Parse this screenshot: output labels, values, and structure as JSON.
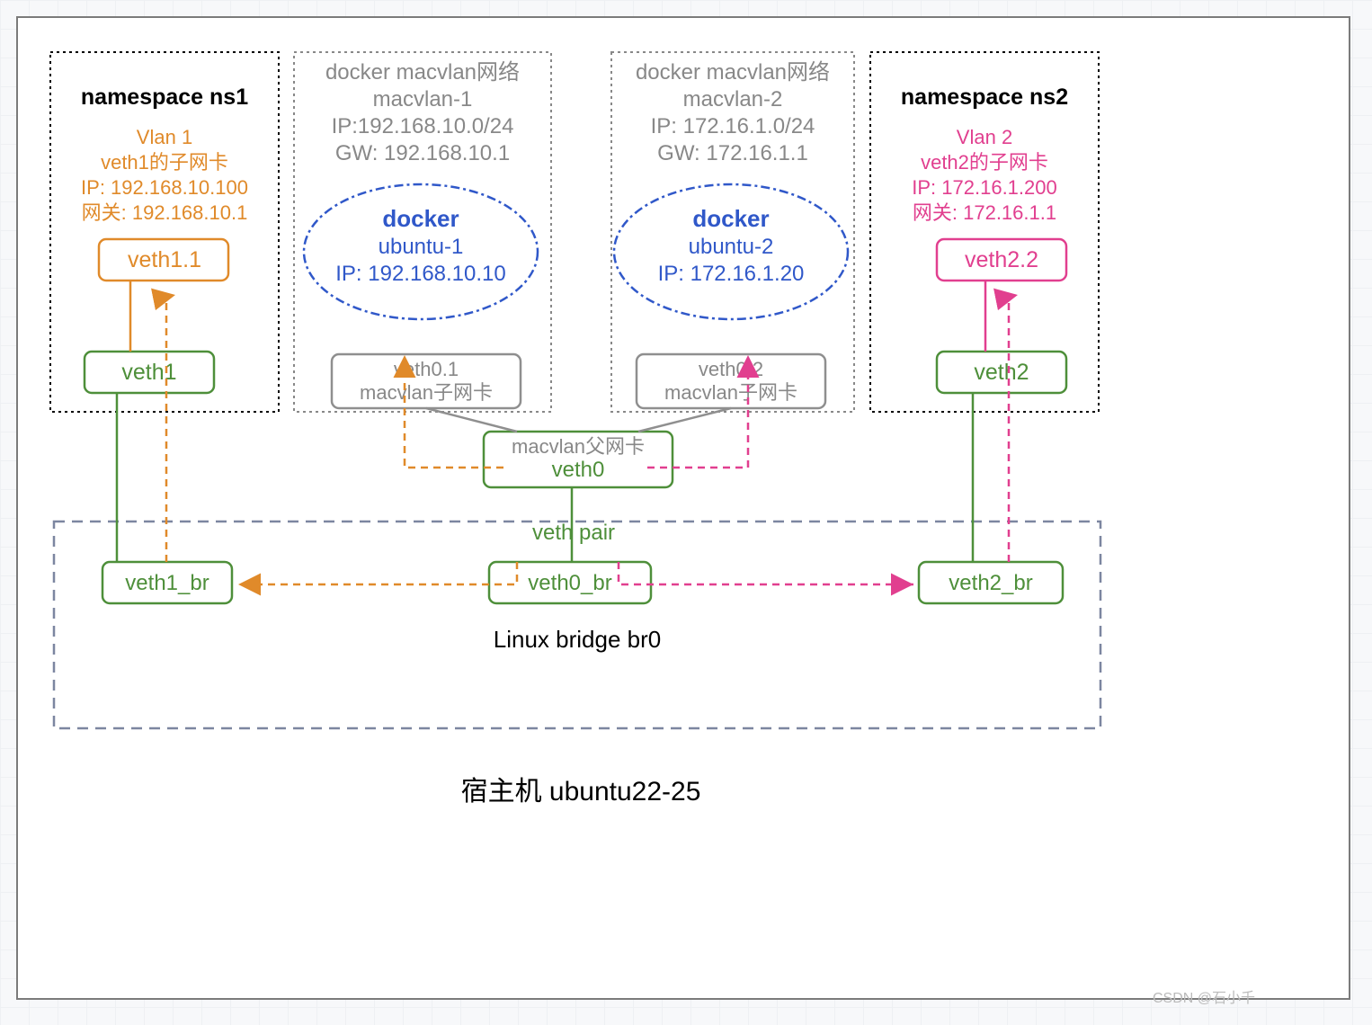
{
  "host": {
    "label": "宿主机 ubuntu22-25"
  },
  "bridge": {
    "label": "Linux bridge br0",
    "box_color": "#7c86a0"
  },
  "veth_pair_label": "veth  pair",
  "ns1": {
    "title": "namespace ns1",
    "vlan_title": "Vlan 1",
    "vlan_sub": "veth1的子网卡",
    "vlan_ip": "IP: 192.168.10.100",
    "vlan_gw": "网关: 192.168.10.1",
    "sub_if": "veth1.1",
    "if": "veth1",
    "color": "#e08a2a"
  },
  "ns2": {
    "title": "namespace ns2",
    "vlan_title": "Vlan 2",
    "vlan_sub": "veth2的子网卡",
    "vlan_ip": "IP: 172.16.1.200",
    "vlan_gw": "网关: 172.16.1.1",
    "sub_if": "veth2.2",
    "if": "veth2",
    "color": "#e13f8f"
  },
  "mvnet1": {
    "title": "docker macvlan网络",
    "name": "macvlan-1",
    "ip": "IP:192.168.10.0/24",
    "gw": "GW: 192.168.10.1",
    "docker_label": "docker",
    "container": "ubuntu-1",
    "container_ip": "IP: 192.168.10.10",
    "sub_if_name": "veth0.1",
    "sub_if_desc": "macvlan子网卡"
  },
  "mvnet2": {
    "title": "docker macvlan网络",
    "name": "macvlan-2",
    "ip": "IP: 172.16.1.0/24",
    "gw": "GW: 172.16.1.1",
    "docker_label": "docker",
    "container": "ubuntu-2",
    "container_ip": "IP: 172.16.1.20",
    "sub_if_name": "veth0.2",
    "sub_if_desc": "macvlan子网卡"
  },
  "parent": {
    "desc": "macvlan父网卡",
    "name": "veth0"
  },
  "br_ports": {
    "p1": "veth1_br",
    "p0": "veth0_br",
    "p2": "veth2_br"
  },
  "colors": {
    "green": "#4e8f3a",
    "gray": "#8f8f8f",
    "blue": "#3058c9",
    "orange": "#e08a2a",
    "pink": "#e13f8f"
  },
  "watermark": "CSDN @石小千"
}
